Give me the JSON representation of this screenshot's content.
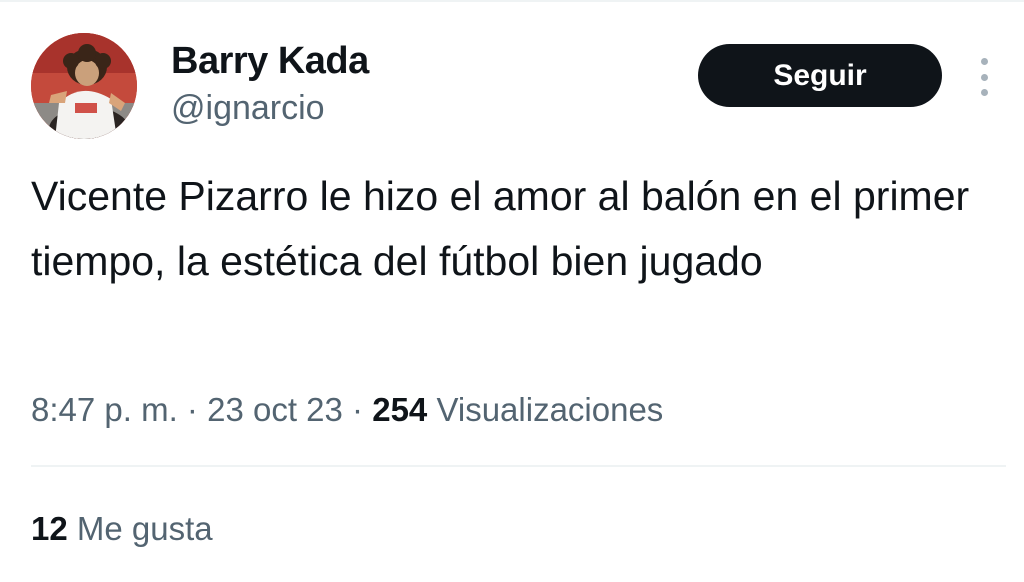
{
  "author": {
    "display_name": "Barry Kada",
    "handle": "@ignarcio"
  },
  "follow_label": "Seguir",
  "tweet": {
    "text": "Vicente Pizarro le hizo el amor al balón en el primer tiempo, la estética del fútbol bien jugado",
    "time": "8:47 p. m.",
    "date": "23 oct 23",
    "separator": "·",
    "views_count": "254",
    "views_label": "Visualizaciones"
  },
  "engagement": {
    "likes_count": "12",
    "likes_label": "Me gusta"
  },
  "icons": {
    "more": "more-vertical-icon"
  }
}
